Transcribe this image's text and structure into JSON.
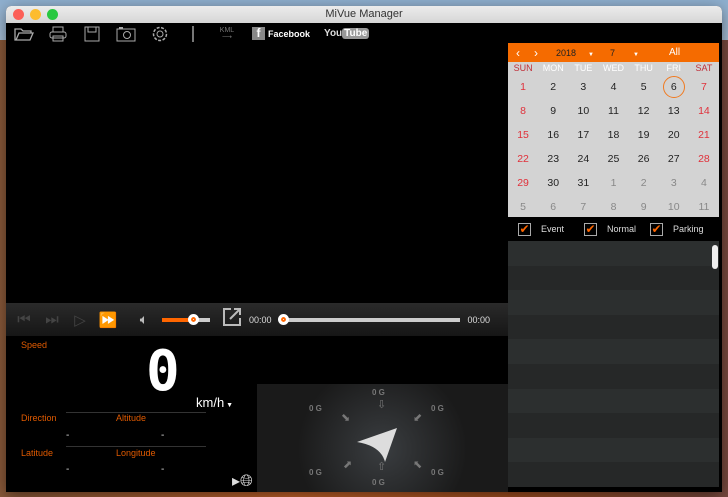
{
  "window": {
    "title": "MiVue Manager"
  },
  "toolbar": {
    "kml_label": "KML",
    "facebook_label": "Facebook",
    "youtube_you": "You",
    "youtube_tube": "Tube"
  },
  "player": {
    "current_time": "00:00",
    "total_time": "00:00",
    "volume_percent": 65,
    "progress_percent": 0
  },
  "dashboard": {
    "speed_label": "Speed",
    "speed_value": "0",
    "speed_unit": "km/h",
    "direction_label": "Direction",
    "direction_value": "-",
    "altitude_label": "Altitude",
    "altitude_value": "-",
    "latitude_label": "Latitude",
    "latitude_value": "-",
    "longitude_label": "Longitude",
    "longitude_value": "-"
  },
  "gsensor": {
    "top": "0 G",
    "bottom": "0 G",
    "top_left": "0 G",
    "top_right": "0 G",
    "bottom_left": "0 G",
    "bottom_right": "0 G"
  },
  "calendar": {
    "year": "2018",
    "month": "7",
    "all_label": "All",
    "selected_day": "6",
    "weekdays": [
      "SUN",
      "MON",
      "TUE",
      "WED",
      "THU",
      "FRI",
      "SAT"
    ],
    "days": [
      "1",
      "2",
      "3",
      "4",
      "5",
      "6",
      "7",
      "8",
      "9",
      "10",
      "11",
      "12",
      "13",
      "14",
      "15",
      "16",
      "17",
      "18",
      "19",
      "20",
      "21",
      "22",
      "23",
      "24",
      "25",
      "26",
      "27",
      "28",
      "29",
      "30",
      "31",
      "1",
      "2",
      "3",
      "4",
      "5",
      "6",
      "7",
      "8",
      "9",
      "10",
      "11"
    ]
  },
  "filters": [
    {
      "label": "Event",
      "checked": true
    },
    {
      "label": "Normal",
      "checked": true
    },
    {
      "label": "Parking",
      "checked": true
    }
  ],
  "colors": {
    "accent": "#f56b00",
    "weekend": "#e0303a"
  }
}
